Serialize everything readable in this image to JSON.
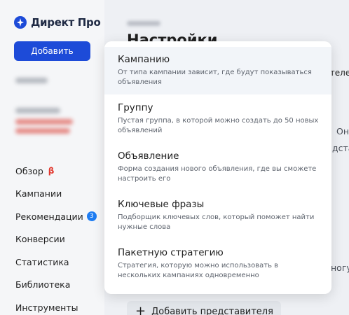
{
  "sidebar": {
    "logo_text": "Директ Про",
    "add_button": "Добавить",
    "nav": [
      {
        "label": "Обзор",
        "badge": "β"
      },
      {
        "label": "Кампании"
      },
      {
        "label": "Рекомендации",
        "count": "3"
      },
      {
        "label": "Конверсии"
      },
      {
        "label": "Статистика"
      },
      {
        "label": "Библиотека"
      },
      {
        "label": "Инструменты"
      }
    ]
  },
  "main": {
    "page_title": "Настройки",
    "tab_peek": "ителе",
    "bg_fragments": [
      "Он",
      "дста",
      "ногу"
    ],
    "add_representative": "Добавить представителя"
  },
  "dropdown": {
    "items": [
      {
        "title": "Кампанию",
        "desc": "От типа кампании зависит, где будут показываться объявления"
      },
      {
        "title": "Группу",
        "desc": "Пустая группа, в которой можно создать до 50 новых объявлений"
      },
      {
        "title": "Объявление",
        "desc": "Форма создания нового объявления, где вы сможете настроить его"
      },
      {
        "title": "Ключевые фразы",
        "desc": "Подборщик ключевых слов, который поможет найти нужные слова"
      },
      {
        "title": "Пакетную стратегию",
        "desc": "Стратегия, которую можно использовать в нескольких кампаниях одновременно"
      }
    ]
  },
  "colors": {
    "accent": "#1d4bd8",
    "beta": "#e2382e",
    "badge": "#1d7cf2"
  }
}
